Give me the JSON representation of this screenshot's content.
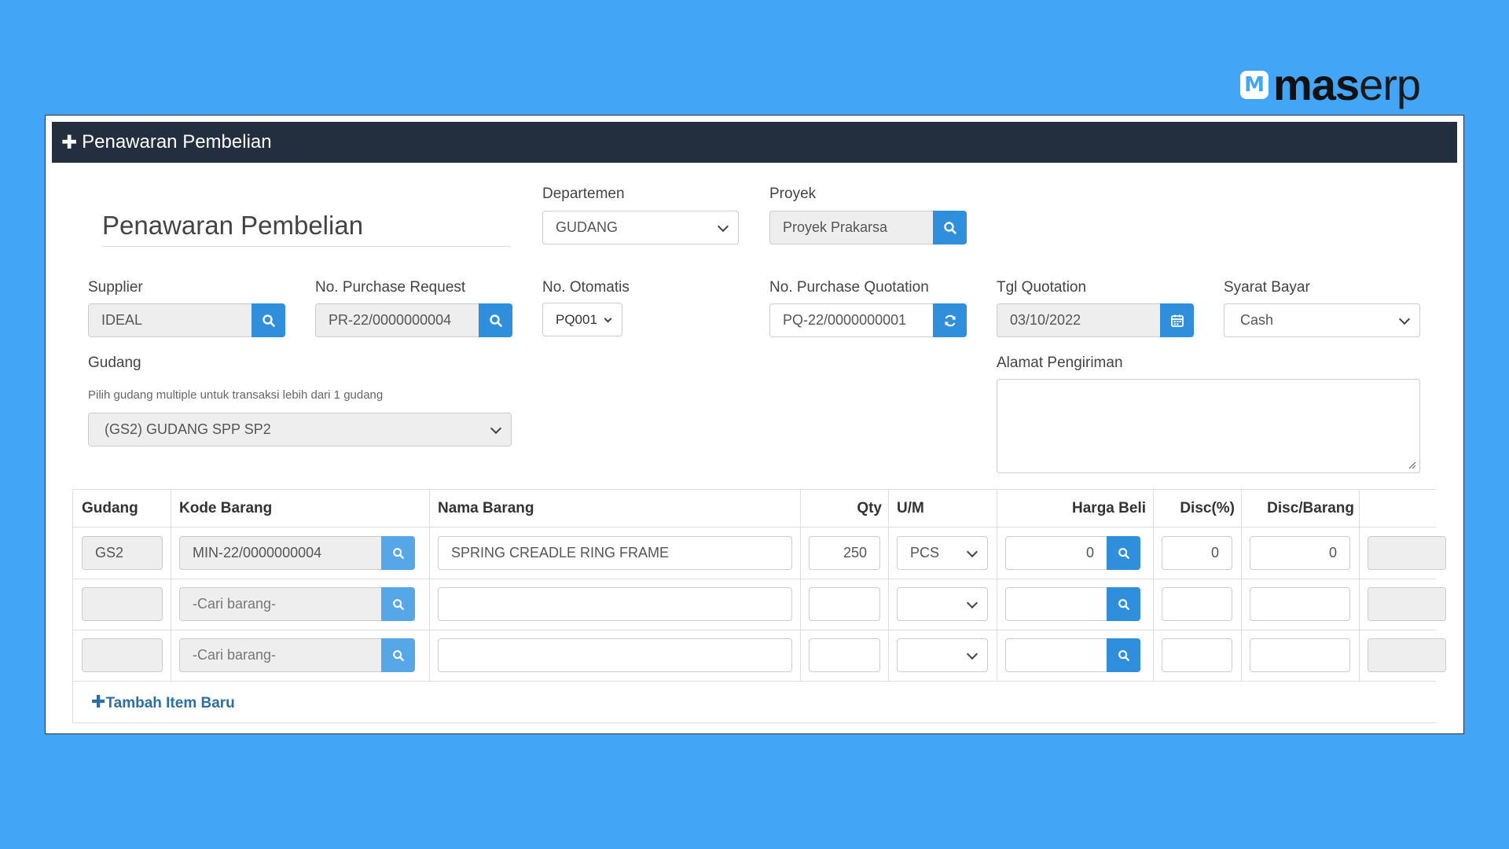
{
  "brand": {
    "mark": "M",
    "name_bold": "mas",
    "name_light": "erp"
  },
  "panel": {
    "title": "Penawaran Pembelian"
  },
  "form": {
    "heading": "Penawaran Pembelian",
    "departemen": {
      "label": "Departemen",
      "value": "GUDANG"
    },
    "proyek": {
      "label": "Proyek",
      "value": "Proyek Prakarsa"
    },
    "supplier": {
      "label": "Supplier",
      "value": "IDEAL"
    },
    "purchase_request": {
      "label": "No. Purchase Request",
      "value": "PR-22/0000000004"
    },
    "otomatis": {
      "label": "No. Otomatis",
      "value": "PQ001"
    },
    "purchase_quotation": {
      "label": "No. Purchase Quotation",
      "value": "PQ-22/0000000001"
    },
    "tgl_quotation": {
      "label": "Tgl Quotation",
      "value": "03/10/2022"
    },
    "syarat_bayar": {
      "label": "Syarat Bayar",
      "value": "Cash"
    },
    "gudang": {
      "label": "Gudang",
      "hint": "Pilih gudang multiple untuk transaksi lebih dari 1 gudang",
      "value": "(GS2) GUDANG SPP SP2"
    },
    "alamat": {
      "label": "Alamat Pengiriman",
      "value": ""
    }
  },
  "table": {
    "headers": {
      "gudang": "Gudang",
      "kode": "Kode Barang",
      "nama": "Nama Barang",
      "qty": "Qty",
      "um": "U/M",
      "harga": "Harga Beli",
      "disc_pct": "Disc(%)",
      "disc_barang": "Disc/Barang"
    },
    "rows": [
      {
        "gudang": "GS2",
        "kode": "MIN-22/0000000004",
        "nama": "SPRING CREADLE RING FRAME",
        "qty": "250",
        "um": "PCS",
        "harga": "0",
        "disc_pct": "0",
        "disc_barang": "0"
      },
      {
        "gudang": "",
        "kode_placeholder": "-Cari barang-",
        "nama": "",
        "qty": "",
        "um": "",
        "harga": "",
        "disc_pct": "",
        "disc_barang": ""
      },
      {
        "gudang": "",
        "kode_placeholder": "-Cari barang-",
        "nama": "",
        "qty": "",
        "um": "",
        "harga": "",
        "disc_pct": "",
        "disc_barang": ""
      }
    ],
    "add_item_label": "Tambah Item Baru"
  },
  "icons": {
    "search": "search-icon",
    "refresh": "refresh-icon",
    "calendar": "calendar-icon",
    "chevron": "chevron-down-icon",
    "plus": "plus-icon"
  },
  "colors": {
    "background": "#42a5f5",
    "header": "#232f3e",
    "button": "#2f8fdc",
    "link": "#2b6fa8"
  }
}
